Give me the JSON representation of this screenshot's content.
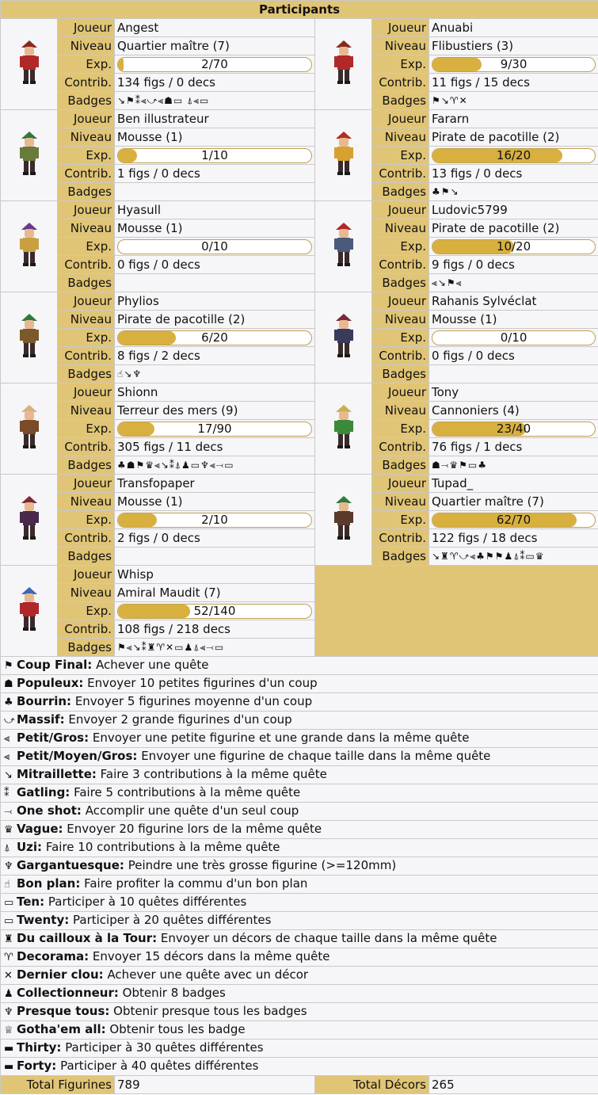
{
  "header": {
    "title": "Participants"
  },
  "labels": {
    "joueur": "Joueur",
    "niveau": "Niveau",
    "exp": "Exp.",
    "contrib": "Contrib.",
    "badges": "Badges"
  },
  "players": [
    {
      "name": "Angest",
      "level": "Quartier maître (7)",
      "exp_text": "2/70",
      "exp_fraction": 0.03,
      "contrib": "134 figs / 0 decs",
      "badges": "↘⚑⁑⫷⤻⫷☗▭ ⍋⫷▭",
      "hat": "#8a2a1c",
      "shirt": "#b02828"
    },
    {
      "name": "Anuabi",
      "level": "Flibustiers (3)",
      "exp_text": "9/30",
      "exp_fraction": 0.3,
      "contrib": "11 figs / 15 decs",
      "badges": "⚑↘♈✕",
      "hat": "#8a2a1c",
      "shirt": "#b02828"
    },
    {
      "name": "Ben illustrateur",
      "level": "Mousse (1)",
      "exp_text": "1/10",
      "exp_fraction": 0.1,
      "contrib": "1 figs / 0 decs",
      "badges": "",
      "hat": "#2f7a3a",
      "shirt": "#6a7a3a"
    },
    {
      "name": "Fararn",
      "level": "Pirate de pacotille (2)",
      "exp_text": "16/20",
      "exp_fraction": 0.8,
      "contrib": "13 figs / 0 decs",
      "badges": "♣⚑↘",
      "hat": "#b03020",
      "shirt": "#d8a030"
    },
    {
      "name": "Hyasull",
      "level": "Mousse (1)",
      "exp_text": "0/10",
      "exp_fraction": 0.0,
      "contrib": "0 figs / 0 decs",
      "badges": "",
      "hat": "#6a3a8a",
      "shirt": "#c8a040"
    },
    {
      "name": "Ludovic5799",
      "level": "Pirate de pacotille (2)",
      "exp_text": "10/20",
      "exp_fraction": 0.5,
      "contrib": "9 figs / 0 decs",
      "badges": "⫷↘⚑⫷",
      "hat": "#b02828",
      "shirt": "#4a5a7a"
    },
    {
      "name": "Phylios",
      "level": "Pirate de pacotille (2)",
      "exp_text": "6/20",
      "exp_fraction": 0.3,
      "contrib": "8 figs / 2 decs",
      "badges": "☝↘♆",
      "hat": "#2f7a3a",
      "shirt": "#7a5a2a"
    },
    {
      "name": "Rahanis Sylvéclat",
      "level": "Mousse (1)",
      "exp_text": "0/10",
      "exp_fraction": 0.0,
      "contrib": "0 figs / 0 decs",
      "badges": "",
      "hat": "#7a2a3a",
      "shirt": "#3a3a5a"
    },
    {
      "name": "Shionn",
      "level": "Terreur des mers (9)",
      "exp_text": "17/90",
      "exp_fraction": 0.19,
      "contrib": "305 figs / 11 decs",
      "badges": "♣☗⚑♛⫷↘⁑⍋♟▭♆⫷⤙▭",
      "hat": "#d8b080",
      "shirt": "#7a4a2a"
    },
    {
      "name": "Tony",
      "level": "Cannoniers (4)",
      "exp_text": "23/40",
      "exp_fraction": 0.575,
      "contrib": "76 figs / 1 decs",
      "badges": "☗⤙♛⚑▭♣",
      "hat": "#c8b050",
      "shirt": "#3a8a3a"
    },
    {
      "name": "Transfopaper",
      "level": "Mousse (1)",
      "exp_text": "2/10",
      "exp_fraction": 0.2,
      "contrib": "2 figs / 0 decs",
      "badges": "",
      "hat": "#7a2a3a",
      "shirt": "#4a2a4a"
    },
    {
      "name": "Tupad_",
      "level": "Quartier maître (7)",
      "exp_text": "62/70",
      "exp_fraction": 0.886,
      "contrib": "122 figs / 18 decs",
      "badges": "↘♜♈⤻⫷♣⚑⚑♟⍋⁑▭♛",
      "hat": "#2f7a3a",
      "shirt": "#5a3a2a"
    },
    {
      "name": "Whisp",
      "level": "Amiral Maudit (7)",
      "exp_text": "52/140",
      "exp_fraction": 0.371,
      "contrib": "108 figs / 218 decs",
      "badges": "⚑⫷↘⁑♜♈✕▭♟⍋⫷⤙▭",
      "hat": "#3a6ab0",
      "shirt": "#b02828"
    }
  ],
  "legend": [
    {
      "icon": "⚑",
      "icon_name": "flag-icon",
      "name": "Coup Final:",
      "desc": "Achever une quête"
    },
    {
      "icon": "☗",
      "icon_name": "small-figures-icon",
      "name": "Populeux:",
      "desc": "Envoyer 10 petites figurines d'un coup"
    },
    {
      "icon": "♣",
      "icon_name": "medium-figures-icon",
      "name": "Bourrin:",
      "desc": "Envoyer 5 figurines moyenne d'un coup"
    },
    {
      "icon": "⤻",
      "icon_name": "large-figures-icon",
      "name": "Massif:",
      "desc": "Envoyer 2 grande figurines d'un coup"
    },
    {
      "icon": "⫷",
      "icon_name": "small-large-icon",
      "name": "Petit/Gros:",
      "desc": "Envoyer une petite figurine et une grande dans la même quête"
    },
    {
      "icon": "⫷",
      "icon_name": "all-sizes-icon",
      "name": "Petit/Moyen/Gros:",
      "desc": "Envoyer une figurine de chaque taille dans la même quête"
    },
    {
      "icon": "↘",
      "icon_name": "mitraillette-icon",
      "name": "Mitraillette:",
      "desc": "Faire 3 contributions à la même quête"
    },
    {
      "icon": "⁑",
      "icon_name": "gatling-icon",
      "name": "Gatling:",
      "desc": "Faire 5 contributions à la même quête"
    },
    {
      "icon": "⤙",
      "icon_name": "one-shot-icon",
      "name": "One shot:",
      "desc": "Accomplir une quête d'un seul coup"
    },
    {
      "icon": "♛",
      "icon_name": "wave-icon",
      "name": "Vague:",
      "desc": "Envoyer 20 figurine lors de la même quête"
    },
    {
      "icon": "⍋",
      "icon_name": "uzi-icon",
      "name": "Uzi:",
      "desc": "Faire 10 contributions à la même quête"
    },
    {
      "icon": "♆",
      "icon_name": "gargantuan-icon",
      "name": "Gargantuesque:",
      "desc": "Peindre une très grosse figurine (>=120mm)"
    },
    {
      "icon": "☝",
      "icon_name": "thumbs-up-icon",
      "name": "Bon plan:",
      "desc": "Faire profiter la commu d'un bon plan"
    },
    {
      "icon": "▭",
      "icon_name": "battery-ten-icon",
      "name": "Ten:",
      "desc": "Participer à 10 quêtes différentes"
    },
    {
      "icon": "▭",
      "icon_name": "battery-twenty-icon",
      "name": "Twenty:",
      "desc": "Participer à 20 quêtes différentes"
    },
    {
      "icon": "♜",
      "icon_name": "tower-icon",
      "name": "Du cailloux à la Tour:",
      "desc": "Envoyer un décors de chaque taille dans la même quête"
    },
    {
      "icon": "♈",
      "icon_name": "decorama-icon",
      "name": "Decorama:",
      "desc": "Envoyer 15 décors dans la même quête"
    },
    {
      "icon": "✕",
      "icon_name": "last-nail-icon",
      "name": "Dernier clou:",
      "desc": "Achever une quête avec un décor"
    },
    {
      "icon": "♟",
      "icon_name": "collector-icon",
      "name": "Collectionneur:",
      "desc": "Obtenir 8 badges"
    },
    {
      "icon": "♆",
      "icon_name": "almost-all-icon",
      "name": "Presque tous:",
      "desc": "Obtenir presque tous les badges"
    },
    {
      "icon": "♕",
      "icon_name": "crown-icon",
      "name": "Gotha'em all:",
      "desc": "Obtenir tous les badge"
    },
    {
      "icon": "▬",
      "icon_name": "battery-thirty-icon",
      "name": "Thirty:",
      "desc": "Participer à 30 quêtes différentes"
    },
    {
      "icon": "▬",
      "icon_name": "battery-forty-icon",
      "name": "Forty:",
      "desc": "Participer à 40 quêtes différentes"
    }
  ],
  "totals": {
    "fig_label": "Total Figurines",
    "fig_value": "789",
    "dec_label": "Total Décors",
    "dec_value": "265"
  }
}
